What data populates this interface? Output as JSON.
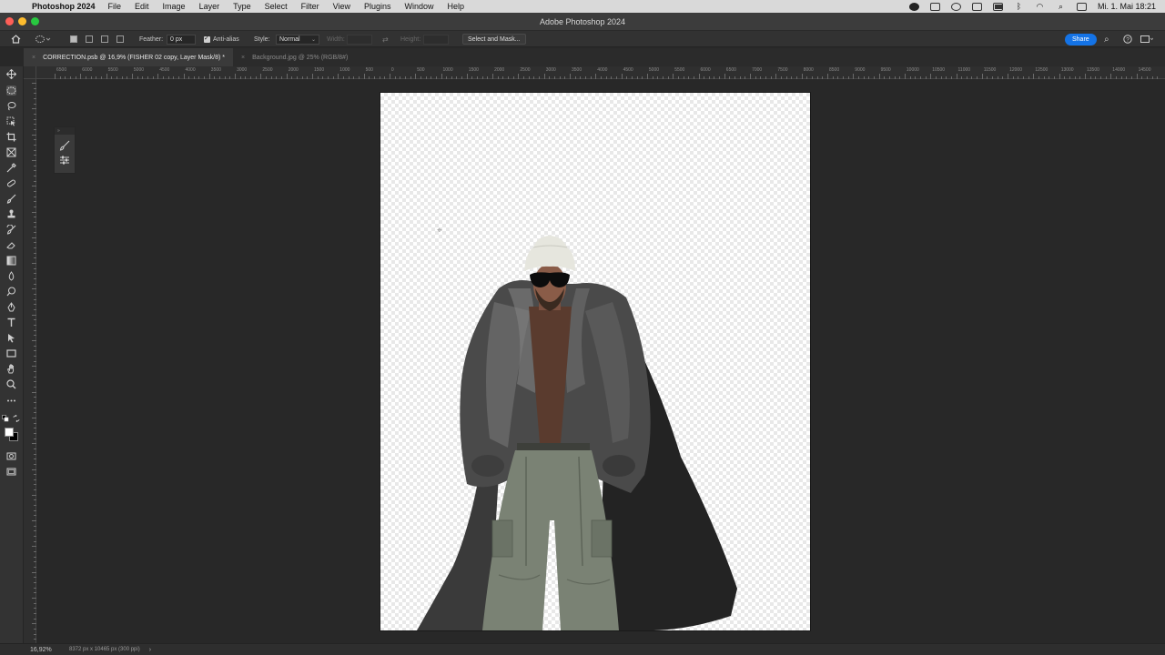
{
  "menubar": {
    "app_name": "Photoshop 2024",
    "items": [
      "File",
      "Edit",
      "Image",
      "Layer",
      "Type",
      "Select",
      "Filter",
      "View",
      "Plugins",
      "Window",
      "Help"
    ],
    "clock": "Mi. 1. Mai 18:21"
  },
  "window": {
    "title": "Adobe Photoshop 2024"
  },
  "options": {
    "feather_label": "Feather:",
    "feather_value": "0 px",
    "antialias_label": "Anti-alias",
    "style_label": "Style:",
    "style_value": "Normal",
    "width_label": "Width:",
    "height_label": "Height:",
    "select_mask_label": "Select and Mask...",
    "share_label": "Share"
  },
  "tabs": [
    {
      "label": "CORRECTION.psb @ 16,9% (FISHER 02 copy, Layer Mask/8) *"
    },
    {
      "label": "Background.jpg @ 25% (RGB/8#)"
    }
  ],
  "ruler": {
    "labels": [
      "6500",
      "6000",
      "5500",
      "5000",
      "4500",
      "4000",
      "3500",
      "3000",
      "2500",
      "2000",
      "1500",
      "1000",
      "500",
      "0",
      "500",
      "1000",
      "1500",
      "2000",
      "2500",
      "3000",
      "3500",
      "4000",
      "4500",
      "5000",
      "5500",
      "6000",
      "6500",
      "7000",
      "7500",
      "8000",
      "8500",
      "9000",
      "9500",
      "10000",
      "10500",
      "11000",
      "11500",
      "12000",
      "12500",
      "13000",
      "13500",
      "14000",
      "14500"
    ]
  },
  "status": {
    "zoom": "16,92%",
    "dimensions": "8372 px x 10465 px (300 ppi)",
    "arrow": "›"
  },
  "colors": {
    "accent": "#1473e6",
    "foreground": "#ffffff",
    "background": "#000000"
  }
}
